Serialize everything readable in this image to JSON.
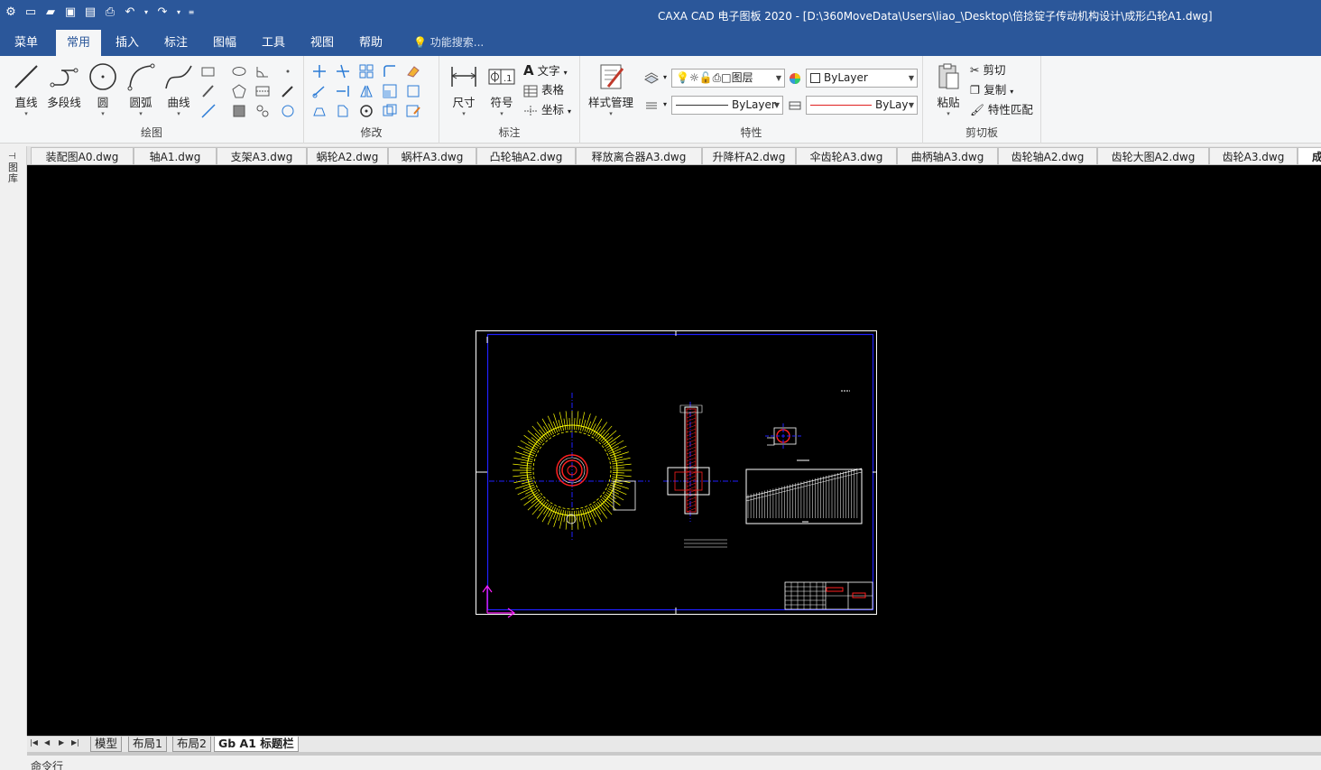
{
  "titlebar": {
    "title": "CAXA CAD 电子图板 2020 - [D:\\360MoveData\\Users\\liao_\\Desktop\\倍捻锭子传动机构设计\\成形凸轮A1.dwg]"
  },
  "menu": {
    "items": [
      "菜单",
      "常用",
      "插入",
      "标注",
      "图幅",
      "工具",
      "视图",
      "帮助"
    ],
    "active": "常用",
    "search_placeholder": "功能搜索..."
  },
  "ribbon": {
    "draw": {
      "label": "绘图",
      "line": "直线",
      "polyline": "多段线",
      "circle": "圆",
      "arc": "圆弧",
      "curve": "曲线"
    },
    "modify": {
      "label": "修改"
    },
    "annotate": {
      "label": "标注",
      "dimension": "尺寸",
      "symbol": "符号",
      "text": "文字",
      "table": "表格",
      "coordinate": "坐标"
    },
    "properties": {
      "label": "特性",
      "style_manager": "样式管理",
      "layer_text": "图层",
      "color": "ByLayer",
      "linetype": "ByLayer",
      "lineweight": "ByLay"
    },
    "clipboard": {
      "label": "剪切板",
      "paste": "粘贴",
      "cut": "剪切",
      "copy": "复制",
      "match": "特性匹配"
    }
  },
  "doc_tabs": [
    "装配图A0.dwg",
    "轴A1.dwg",
    "支架A3.dwg",
    "蜗轮A2.dwg",
    "蜗杆A3.dwg",
    "凸轮轴A2.dwg",
    "释放离合器A3.dwg",
    "升降杆A2.dwg",
    "伞齿轮A3.dwg",
    "曲柄轴A3.dwg",
    "齿轮轴A2.dwg",
    "齿轮大图A2.dwg",
    "齿轮A3.dwg",
    "成"
  ],
  "left_panel": {
    "label": "图库"
  },
  "layout_tabs": [
    "模型",
    "布局1",
    "布局2",
    "Gb A1 标题栏"
  ],
  "active_layout": "Gb A1 标题栏",
  "command_line": {
    "label": "命令行"
  },
  "colors": {
    "accent": "#2b579a",
    "canvas": "#000000",
    "drawing_yellow": "#ffff00",
    "drawing_blue": "#0000ff",
    "drawing_red": "#ff0000"
  }
}
